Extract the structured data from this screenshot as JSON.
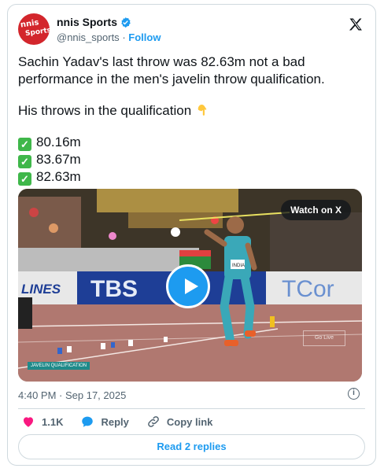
{
  "account": {
    "name": "nnis Sports",
    "handle": "@nnis_sports",
    "separator": "·",
    "follow_label": "Follow",
    "avatar_text_1": "nnis",
    "avatar_text_2": "Sports"
  },
  "tweet": {
    "line1": "Sachin Yadav's last throw was 82.63m not a bad performance in the men's javelin throw qualification.",
    "line2": "His throws in the qualification",
    "throws": [
      "80.16m",
      "83.67m",
      "82.63m"
    ],
    "check_glyph": "✓"
  },
  "media": {
    "watch_label": "Watch on X",
    "banner_texts": [
      "LINES",
      "TBS",
      "TCor"
    ],
    "bib_text": "INDIA",
    "go_live": "Go Live",
    "caption_tag": "JAVELIN QUALIFICATION"
  },
  "meta": {
    "timestamp": "4:40 PM · Sep 17, 2025",
    "info_glyph": "i"
  },
  "actions": {
    "likes": "1.1K",
    "reply_label": "Reply",
    "copy_label": "Copy link"
  },
  "footer": {
    "replies_label": "Read 2 replies"
  },
  "icons": [
    "verified-icon",
    "x-logo-icon",
    "pointing-down-icon",
    "checkmark-icon",
    "play-icon",
    "info-icon",
    "heart-icon",
    "reply-icon",
    "link-icon"
  ],
  "colors": {
    "accent": "#1d9bf0",
    "heart": "#f91880",
    "check": "#3fb74a",
    "avatar": "#d3262c"
  }
}
